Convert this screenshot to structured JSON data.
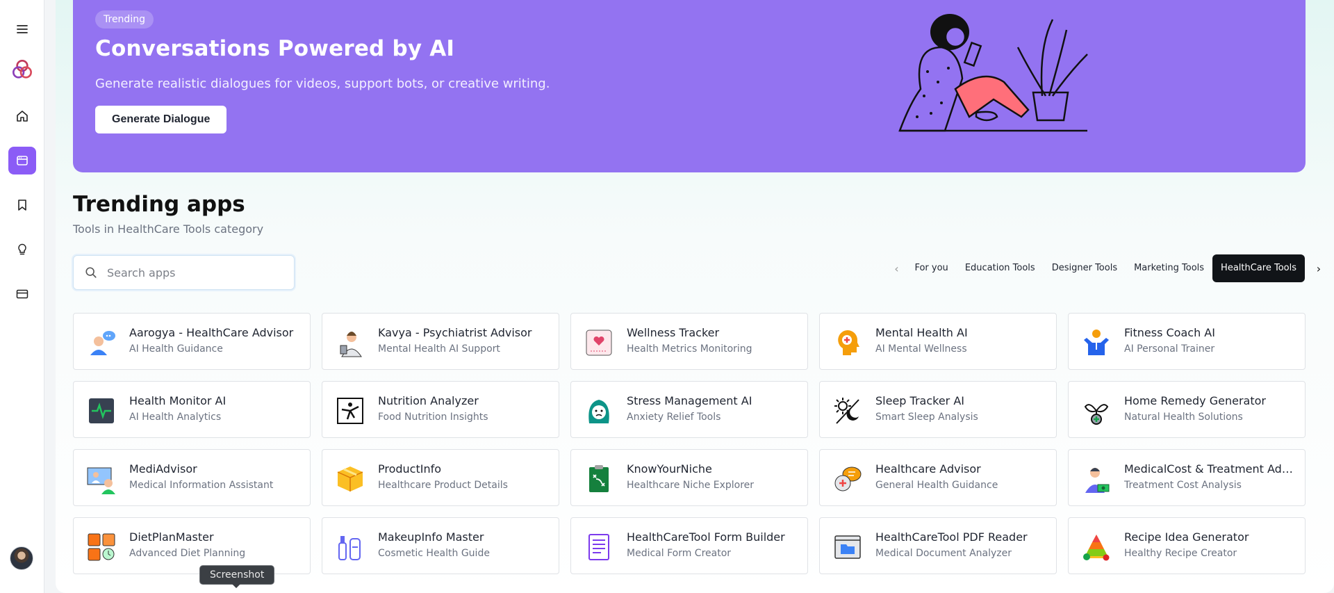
{
  "sidebar": {
    "items": [
      {
        "icon": "menu-icon"
      },
      {
        "icon": "logo-icon"
      },
      {
        "icon": "home-icon"
      },
      {
        "icon": "apps-icon",
        "active": true
      },
      {
        "icon": "bookmark-icon"
      },
      {
        "icon": "lightbulb-icon"
      },
      {
        "icon": "card-icon"
      }
    ],
    "accent": "#8b5cf6"
  },
  "hero": {
    "badge": "Trending",
    "title": "Conversations Powered by AI",
    "subtitle": "Generate realistic dialogues for videos, support bots, or creative writing.",
    "button": "Generate Dialogue",
    "color": "#9373f1"
  },
  "section": {
    "title": "Trending apps",
    "subtitle": "Tools in HealthCare Tools category"
  },
  "search": {
    "placeholder": "Search apps"
  },
  "tabs": [
    {
      "label": "For you"
    },
    {
      "label": "Education Tools"
    },
    {
      "label": "Designer Tools"
    },
    {
      "label": "Marketing Tools"
    },
    {
      "label": "HealthCare Tools",
      "active": true
    }
  ],
  "apps": [
    {
      "title": "Aarogya - HealthCare Advisor",
      "sub": "AI Health Guidance",
      "icon": "doctor-chat-icon"
    },
    {
      "title": "Kavya - Psychiatrist Advisor",
      "sub": "Mental Health AI Support",
      "icon": "psychiatrist-icon"
    },
    {
      "title": "Wellness Tracker",
      "sub": "Health Metrics Monitoring",
      "icon": "heart-monitor-icon"
    },
    {
      "title": "Mental Health AI",
      "sub": "AI Mental Wellness",
      "icon": "head-cross-icon"
    },
    {
      "title": "Fitness Coach AI",
      "sub": "AI Personal Trainer",
      "icon": "trainer-icon"
    },
    {
      "title": "Health Monitor AI",
      "sub": "AI Health Analytics",
      "icon": "pulse-icon"
    },
    {
      "title": "Nutrition Analyzer",
      "sub": "Food Nutrition Insights",
      "icon": "stretch-figure-icon"
    },
    {
      "title": "Stress Management AI",
      "sub": "Anxiety Relief Tools",
      "icon": "stressed-face-icon"
    },
    {
      "title": "Sleep Tracker AI",
      "sub": "Smart Sleep Analysis",
      "icon": "sun-moon-icon"
    },
    {
      "title": "Home Remedy Generator",
      "sub": "Natural Health Solutions",
      "icon": "herb-icon"
    },
    {
      "title": "MediAdvisor",
      "sub": "Medical Information Assistant",
      "icon": "video-consult-icon"
    },
    {
      "title": "ProductInfo",
      "sub": "Healthcare Product Details",
      "icon": "box-icon"
    },
    {
      "title": "KnowYourNiche",
      "sub": "Healthcare Niche Explorer",
      "icon": "clipboard-plan-icon"
    },
    {
      "title": "Healthcare Advisor",
      "sub": "General Health Guidance",
      "icon": "chat-plus-icon"
    },
    {
      "title": "MedicalCost & Treatment Advisor",
      "sub": "Treatment Cost Analysis",
      "icon": "doctor-money-icon"
    },
    {
      "title": "DietPlanMaster",
      "sub": "Advanced Diet Planning",
      "icon": "diet-grid-icon"
    },
    {
      "title": "MakeupInfo Master",
      "sub": "Cosmetic Health Guide",
      "icon": "cosmetics-icon"
    },
    {
      "title": "HealthCareTool Form Builder",
      "sub": "Medical Form Creator",
      "icon": "form-icon"
    },
    {
      "title": "HealthCareTool PDF Reader",
      "sub": "Medical Document Analyzer",
      "icon": "folder-window-icon"
    },
    {
      "title": "Recipe Idea Generator",
      "sub": "Healthy Recipe Creator",
      "icon": "food-pyramid-icon"
    }
  ],
  "tooltip": "Screenshot"
}
